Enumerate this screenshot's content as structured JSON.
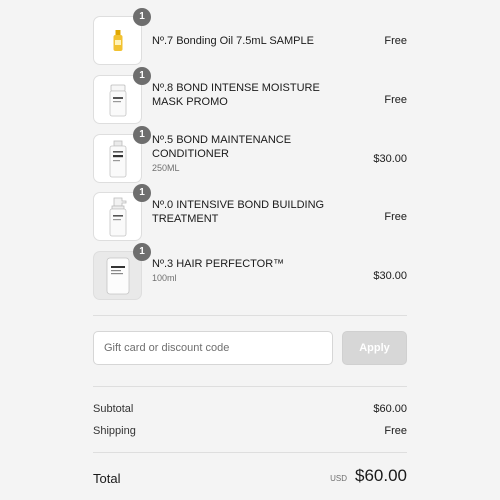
{
  "line_items": [
    {
      "name": "Nº.7 Bonding Oil 7.5mL SAMPLE",
      "variant": "",
      "quantity": "1",
      "price": "Free",
      "image_icon": "oil-bottle-icon"
    },
    {
      "name": "Nº.8 BOND INTENSE MOISTURE MASK PROMO",
      "variant": "",
      "quantity": "1",
      "price": "Free",
      "image_icon": "mask-jar-icon"
    },
    {
      "name": "Nº.5 BOND MAINTENANCE CONDITIONER",
      "variant": "250ML",
      "quantity": "1",
      "price": "$30.00",
      "image_icon": "conditioner-bottle-icon"
    },
    {
      "name": "Nº.0 INTENSIVE BOND BUILDING TREATMENT",
      "variant": "",
      "quantity": "1",
      "price": "Free",
      "image_icon": "spray-bottle-icon"
    },
    {
      "name": "Nº.3 HAIR PERFECTOR™",
      "variant": "100ml",
      "quantity": "1",
      "price": "$30.00",
      "image_icon": "tube-icon"
    }
  ],
  "discount": {
    "placeholder": "Gift card or discount code",
    "apply_label": "Apply"
  },
  "totals": {
    "subtotal_label": "Subtotal",
    "subtotal_value": "$60.00",
    "shipping_label": "Shipping",
    "shipping_value": "Free",
    "total_label": "Total",
    "currency": "USD",
    "total_value": "$60.00"
  },
  "colors": {
    "background": "#f4f4f4",
    "badge": "#6e6e6e",
    "apply_disabled": "#d7d7d7",
    "oil_yellow": "#f2c230"
  }
}
